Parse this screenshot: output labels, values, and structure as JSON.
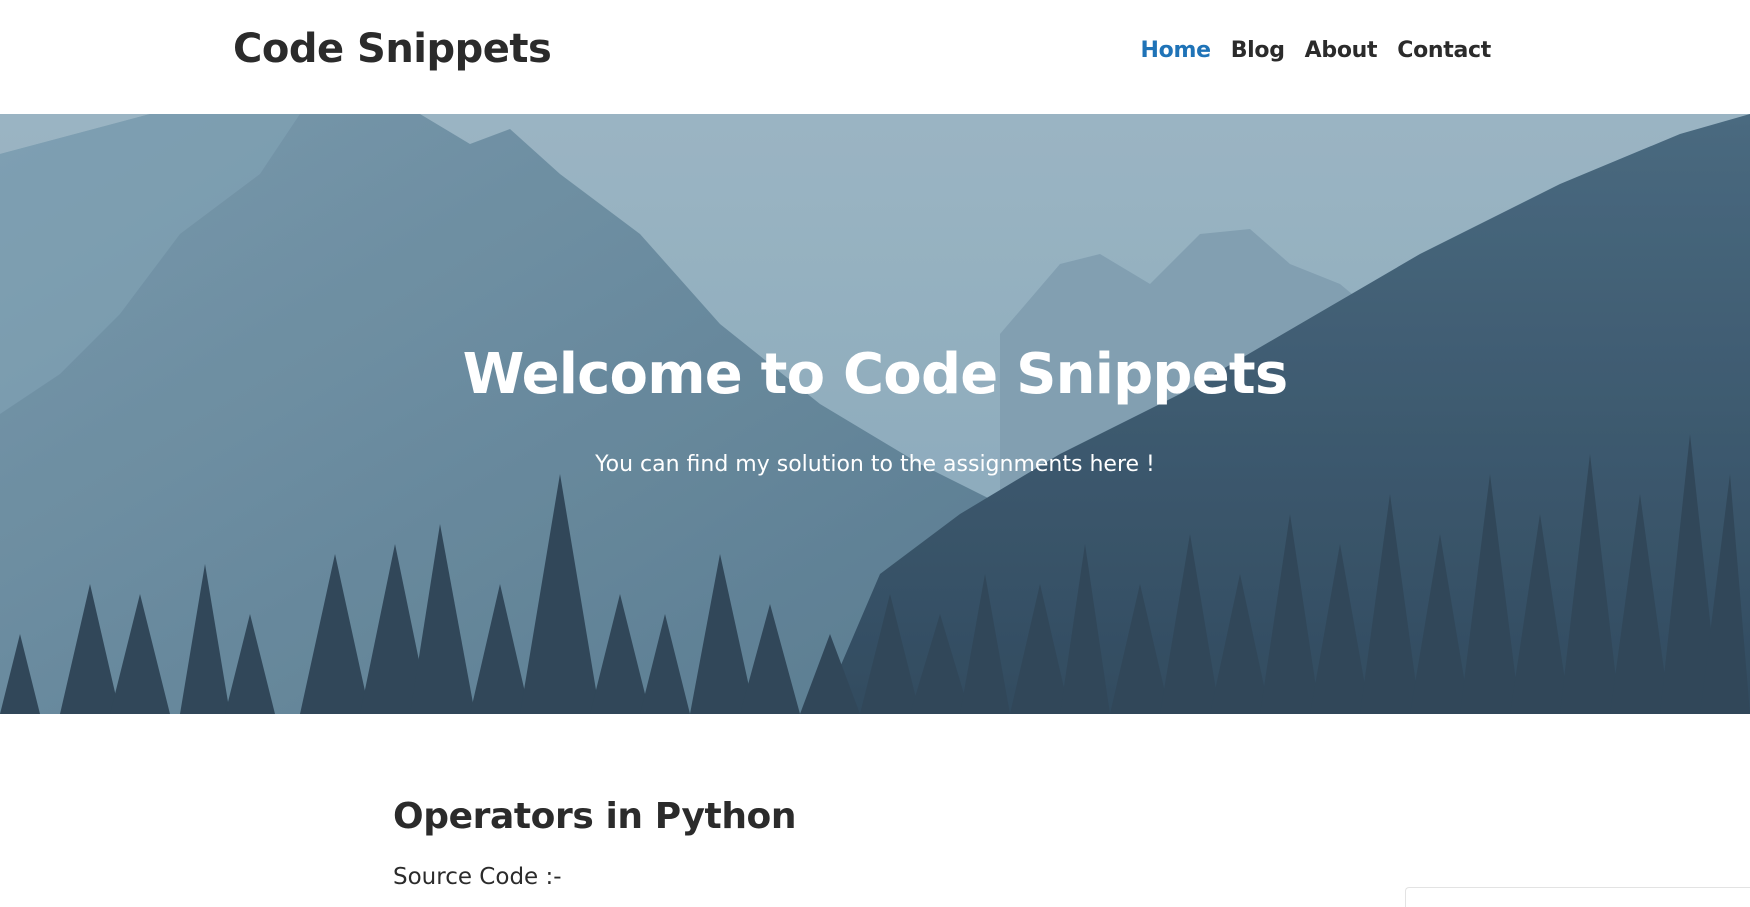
{
  "site": {
    "title": "Code Snippets"
  },
  "nav": {
    "items": [
      {
        "label": "Home",
        "active": true
      },
      {
        "label": "Blog",
        "active": false
      },
      {
        "label": "About",
        "active": false
      },
      {
        "label": "Contact",
        "active": false
      }
    ]
  },
  "hero": {
    "title": "Welcome to Code Snippets",
    "subtitle": "You can find my solution to the assignments here !",
    "image": "mountain-forest-background"
  },
  "post": {
    "title": "Operators in Python",
    "source_label": "Source Code :-"
  },
  "colors": {
    "accent": "#1f73b7",
    "text": "#2b2b2b",
    "hero_text": "#ffffff"
  }
}
